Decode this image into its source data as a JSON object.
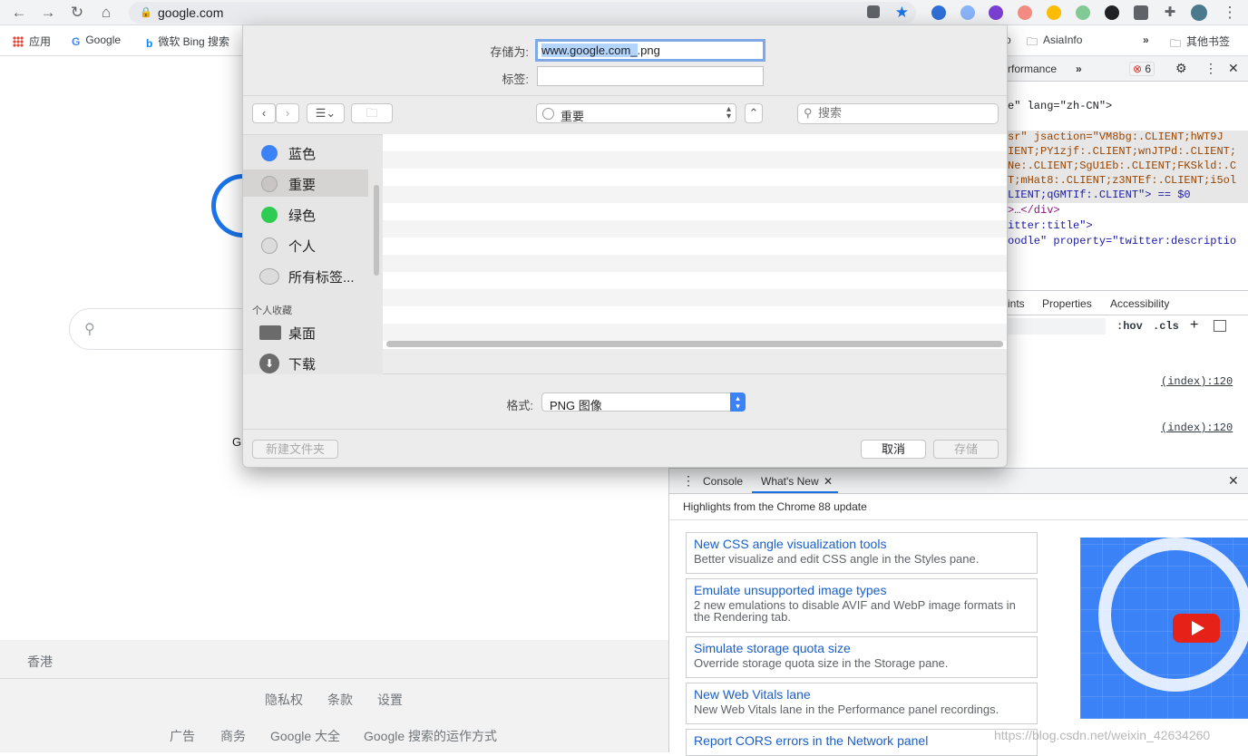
{
  "browser": {
    "url": "google.com",
    "bookmarks": {
      "apps": "应用",
      "google": "Google",
      "bing": "微软 Bing 搜索",
      "asiainfo": "AsiaInfo",
      "overflow": "»",
      "other": "其他书签",
      "partial": "o"
    }
  },
  "google_page": {
    "partial_text": "G",
    "region": "香港",
    "footer_row1": [
      "隐私权",
      "条款",
      "设置"
    ],
    "footer_row2": [
      "广告",
      "商务",
      "Google 大全",
      "Google 搜索的运作方式"
    ]
  },
  "save_dialog": {
    "save_as_label": "存储为:",
    "save_as_selected": "www.google.com_",
    "save_as_rest": ".png",
    "tags_label": "标签:",
    "location": "重要",
    "search_placeholder": "搜索",
    "sidebar_tags": [
      {
        "label": "蓝色",
        "color": "#3b82f6"
      },
      {
        "label": "重要",
        "color": "#c9c5c5"
      },
      {
        "label": "绿色",
        "color": "#2fcc52"
      },
      {
        "label": "个人",
        "color": "#dcdcdc"
      },
      {
        "label": "所有标签...",
        "color": "#dcdcdc"
      }
    ],
    "favorites_title": "个人收藏",
    "favorites": [
      {
        "label": "桌面",
        "icon": "desktop-icon"
      },
      {
        "label": "下载",
        "icon": "download-icon"
      }
    ],
    "format_label": "格式:",
    "format_value": "PNG 图像",
    "new_folder": "新建文件夹",
    "cancel": "取消",
    "save": "存储"
  },
  "devtools": {
    "tabs": {
      "performance": "rformance",
      "more": "»",
      "errors": "6"
    },
    "elements_lines": [
      {
        "text": "e\" lang=\"zh-CN\">"
      },
      {
        "text": "sr\" jsaction=\"VM8bg:.CLIENT;hWT9J"
      },
      {
        "text": "IENT;PY1zjf:.CLIENT;wnJTPd:.CLIENT;"
      },
      {
        "text": "Ne:.CLIENT;SgU1Eb:.CLIENT;FKSkld:.C"
      },
      {
        "text": "T;mHat8:.CLIENT;z3NTEf:.CLIENT;i5ol"
      },
      {
        "text": "LIENT;qGMTIf:.CLIENT\"> == $0"
      },
      {
        "text": ">…</div>"
      },
      {
        "text": "itter:title\">"
      },
      {
        "text": "oodle\" property=\"twitter:descriptio"
      }
    ],
    "styles_tabs": [
      "ints",
      "Properties",
      "Accessibility"
    ],
    "filter_tools": {
      "hov": ":hov",
      "cls": ".cls",
      "plus": "+"
    },
    "index_refs": [
      "(index):120",
      "(index):120"
    ],
    "drawer_tabs": {
      "console": "Console",
      "whats_new": "What's New"
    },
    "highlights": "Highlights from the Chrome 88 update",
    "cards": [
      {
        "title": "New CSS angle visualization tools",
        "desc": "Better visualize and edit CSS angle in the Styles pane."
      },
      {
        "title": "Emulate unsupported image types",
        "desc": "2 new emulations to disable AVIF and WebP image formats in the Rendering tab."
      },
      {
        "title": "Simulate storage quota size",
        "desc": "Override storage quota size in the Storage pane."
      },
      {
        "title": "New Web Vitals lane",
        "desc": "New Web Vitals lane in the Performance panel recordings."
      },
      {
        "title": "Report CORS errors in the Network panel",
        "desc": ""
      }
    ]
  },
  "watermark": "https://blog.csdn.net/weixin_42634260",
  "colors": {
    "accent": "#1a73e8",
    "link": "#1a5fc7"
  }
}
